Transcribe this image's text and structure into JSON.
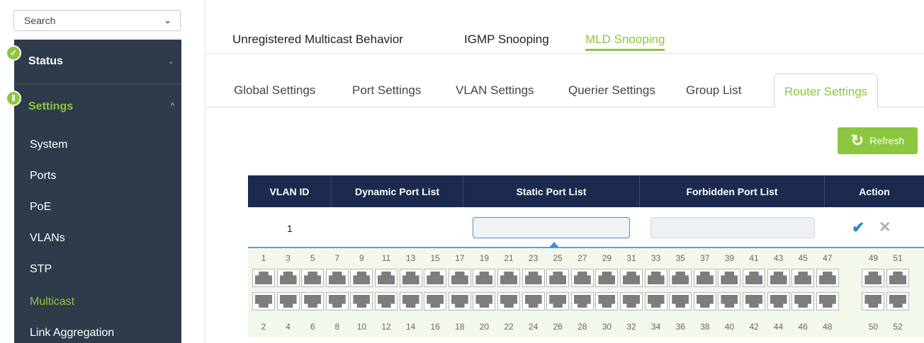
{
  "sidebar": {
    "search_label": "Search",
    "status_label": "Status",
    "settings_label": "Settings",
    "items": [
      "System",
      "Ports",
      "PoE",
      "VLANs",
      "STP",
      "Multicast",
      "Link Aggregation"
    ],
    "active_item": "Multicast"
  },
  "top_tabs": [
    "Unregistered Multicast Behavior",
    "IGMP Snooping",
    "MLD Snooping"
  ],
  "top_tab_active": "MLD Snooping",
  "sub_tabs": [
    "Global Settings",
    "Port Settings",
    "VLAN Settings",
    "Querier Settings",
    "Group List",
    "Router Settings"
  ],
  "sub_tab_active": "Router Settings",
  "refresh_label": "Refresh",
  "table": {
    "headers": [
      "VLAN ID",
      "Dynamic Port List",
      "Static Port List",
      "Forbidden Port List",
      "Action"
    ],
    "rows": [
      {
        "vlan_id": "1",
        "dynamic": "",
        "static": "",
        "forbidden": ""
      }
    ]
  },
  "ports": {
    "top_numbers": [
      "1",
      "3",
      "5",
      "7",
      "9",
      "11",
      "13",
      "15",
      "17",
      "19",
      "21",
      "23",
      "25",
      "27",
      "29",
      "31",
      "33",
      "35",
      "37",
      "39",
      "41",
      "43",
      "45",
      "47",
      "49",
      "51"
    ],
    "bottom_numbers": [
      "2",
      "4",
      "6",
      "8",
      "10",
      "12",
      "14",
      "16",
      "18",
      "20",
      "22",
      "24",
      "26",
      "28",
      "30",
      "32",
      "34",
      "36",
      "38",
      "40",
      "42",
      "44",
      "46",
      "48",
      "50",
      "52"
    ]
  },
  "colors": {
    "accent": "#8dc63f",
    "header": "#1b2a4e",
    "sidebar": "#2f3b4a",
    "link_blue": "#2a87d4"
  },
  "icons": {
    "status": "check-icon",
    "settings": "sliders-icon",
    "refresh": "refresh-icon",
    "confirm": "checkmark-icon",
    "cancel": "close-icon"
  }
}
